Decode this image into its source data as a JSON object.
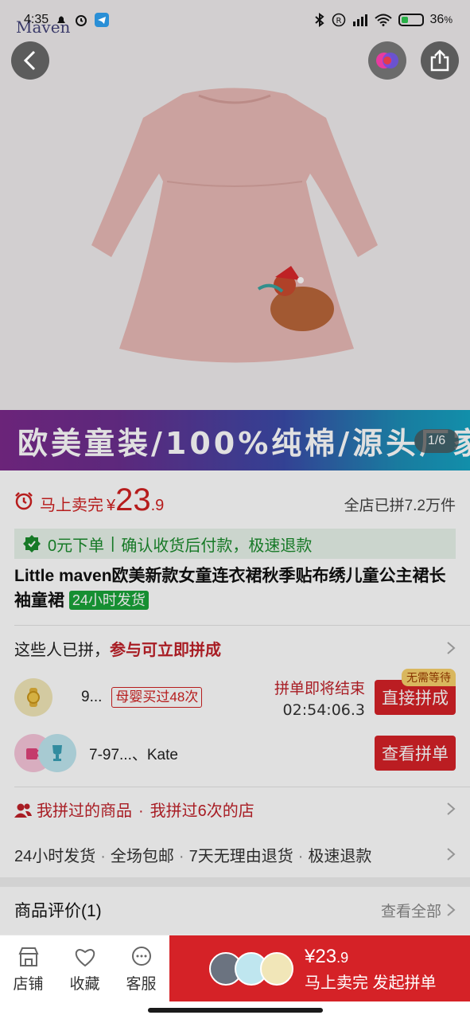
{
  "status_bar": {
    "time": "4:35",
    "battery": "36",
    "battery_unit": "%",
    "battery_level": 0.36
  },
  "brand": {
    "logo_text": "Maven"
  },
  "hero": {
    "page_indicator": "1/6"
  },
  "banner": {
    "text": "欧美童装/100%纯棉/源头厂家"
  },
  "price": {
    "sale_label": "马上卖完",
    "currency": "¥",
    "integer": "23",
    "decimal": ".9",
    "sold": "全店已拼7.2万件"
  },
  "guarantee": {
    "part1": "0元下单",
    "separator": "|",
    "part2": "确认收货后付款，极速退款"
  },
  "product": {
    "title": "Little maven欧美新款女童连衣裙秋季贴布绣儿童公主裙长袖童裙",
    "ship_badge": "24小时发货"
  },
  "group": {
    "header_prefix": "这些人已拼，",
    "header_highlight": "参与可立即拼成",
    "rows": [
      {
        "name": "9...",
        "tag": "母婴买过48次",
        "status": "拼单即将结束",
        "countdown": "02:54:06.3",
        "button": "直接拼成",
        "badge": "无需等待"
      },
      {
        "name": "7-97...、Kate",
        "button": "查看拼单"
      }
    ]
  },
  "history": {
    "item1": "我拼过的商品",
    "dot": "·",
    "item2": "我拼过6次的店"
  },
  "services": {
    "items": [
      "24小时发货",
      "全场包邮",
      "7天无理由退货",
      "极速退款"
    ],
    "dot": "·"
  },
  "reviews": {
    "label": "商品评价(1)",
    "more": "查看全部"
  },
  "bottom_bar": {
    "tabs": [
      {
        "label": "店铺",
        "icon": "store-icon"
      },
      {
        "label": "收藏",
        "icon": "heart-icon"
      },
      {
        "label": "客服",
        "icon": "chat-icon"
      }
    ],
    "buy": {
      "currency": "¥",
      "integer": "23",
      "decimal": ".9",
      "label": "马上卖完 发起拼单"
    }
  },
  "colors": {
    "accent_red": "#d52227",
    "green": "#1a8a2c",
    "badge_green": "#1aa33a"
  }
}
